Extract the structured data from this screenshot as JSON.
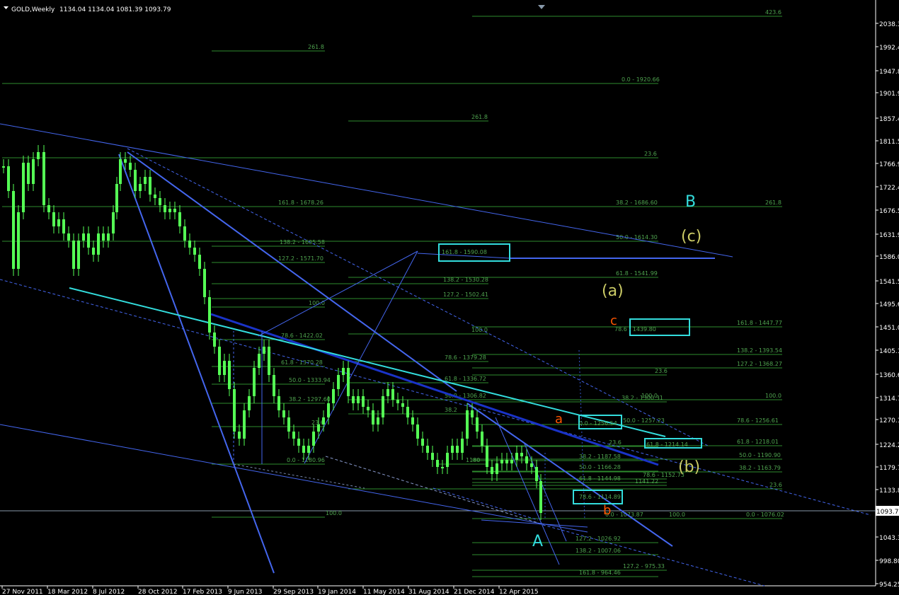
{
  "header": {
    "symbol": "GOLD,Weekly",
    "ohlc": "1134.04 1134.04 1081.39 1093.79"
  },
  "colors": {
    "background": "#000000",
    "bull_candle": "#55ff55",
    "fib_line": "#2e8b2e",
    "fib_text": "#4fa34f",
    "trend_line": "#4466ee",
    "dark_trend": "#1a33c8",
    "cyan": "#33dddd",
    "olive_label": "#cccc66",
    "orange_label": "#ff5500",
    "axis_text": "#ffffff"
  },
  "price_axis": {
    "labels": [
      "2038.30",
      "1992.40",
      "1947.85",
      "1901.95",
      "1857.40",
      "1811.50",
      "1766.95",
      "1722.40",
      "1676.50",
      "1631.95",
      "1586.05",
      "1541.50",
      "1495.60",
      "1451.05",
      "1405.15",
      "1360.60",
      "1314.70",
      "1270.15",
      "1224.25",
      "1179.70",
      "1133.80",
      "1093.79",
      "1043.35",
      "998.80",
      "954.25"
    ],
    "current_price": "1093.79"
  },
  "time_axis": {
    "labels": [
      "27 Nov 2011",
      "18 Mar 2012",
      "8 Jul 2012",
      "28 Oct 2012",
      "17 Feb 2013",
      "9 Jun 2013",
      "29 Sep 2013",
      "19 Jan 2014",
      "11 May 2014",
      "31 Aug 2014",
      "21 Dec 2014",
      "12 Apr 2015"
    ]
  },
  "wave_labels": {
    "A": "A",
    "B": "B",
    "a_paren": "(a)",
    "b_paren": "(b)",
    "c_paren": "(c)",
    "a_small": "a",
    "b_small": "b",
    "c_small": "c"
  },
  "fib_levels": [
    {
      "text": "423.6"
    },
    {
      "text": "261.8"
    },
    {
      "text": "0.0 - 1920.66"
    },
    {
      "text": "261.8"
    },
    {
      "text": "23.6"
    },
    {
      "text": "161.8 - 1678.26"
    },
    {
      "text": "38.2 - 1686.60"
    },
    {
      "text": "261.8"
    },
    {
      "text": "50.0 - 1614.30"
    },
    {
      "text": "138.2 - 1605.58"
    },
    {
      "text": "127.2 - 1571.70"
    },
    {
      "text": "61.8 - 1541.99"
    },
    {
      "text": "138.2 - 1530.28"
    },
    {
      "text": "127.2 - 1502.41"
    },
    {
      "text": "100.0"
    },
    {
      "text": "161.8 - 1447.77"
    },
    {
      "text": "100.0"
    },
    {
      "text": "78.6 - 1422.02"
    },
    {
      "text": "138.2 - 1393.54"
    },
    {
      "text": "78.6 - 1379.28"
    },
    {
      "text": "61.8 - 1370.28"
    },
    {
      "text": "127.2 - 1368.27"
    },
    {
      "text": "23.6"
    },
    {
      "text": "61.8 - 1336.72"
    },
    {
      "text": "50.0 - 1333.94"
    },
    {
      "text": "50.0 - 1306.82"
    },
    {
      "text": "100.0"
    },
    {
      "text": "38.2 - 1300.31"
    },
    {
      "text": "100.0"
    },
    {
      "text": "38.2 - 1297.60"
    },
    {
      "text": "38.2"
    },
    {
      "text": "50.0 - 1257.23"
    },
    {
      "text": "78.6 - 1256.61"
    },
    {
      "text": "23.6"
    },
    {
      "text": "23.6"
    },
    {
      "text": "61.8 - 1218.01"
    },
    {
      "text": "50.0 - 1190.90"
    },
    {
      "text": "38.2 - 1187.58"
    },
    {
      "text": "0.0 - 1180.96"
    },
    {
      "text": "50.0 - 1166.28"
    },
    {
      "text": "38.2 - 1163.79"
    },
    {
      "text": "78.6 - 1152.73"
    },
    {
      "text": "61.8 - 1144.98"
    },
    {
      "text": "1141.22"
    },
    {
      "text": "23.6"
    },
    {
      "text": "100.0"
    },
    {
      "text": "0.0 - 1073.87"
    },
    {
      "text": "100.0"
    },
    {
      "text": "0.0 - 1076.02"
    },
    {
      "text": "127.2 - 1026.92"
    },
    {
      "text": "138.2 - 1007.06"
    },
    {
      "text": "127.2 - 975.33"
    },
    {
      "text": "161.8 - 964.46"
    },
    {
      "text": "1180"
    }
  ],
  "boxes": [
    {
      "text": "161.8 - 1590.08"
    },
    {
      "text": "78.6 - 1439.80"
    },
    {
      "text": "0.0 - 1256.54"
    },
    {
      "text": "61.8 - 1214.14"
    },
    {
      "text": "78.6 - 1114.89"
    }
  ]
}
